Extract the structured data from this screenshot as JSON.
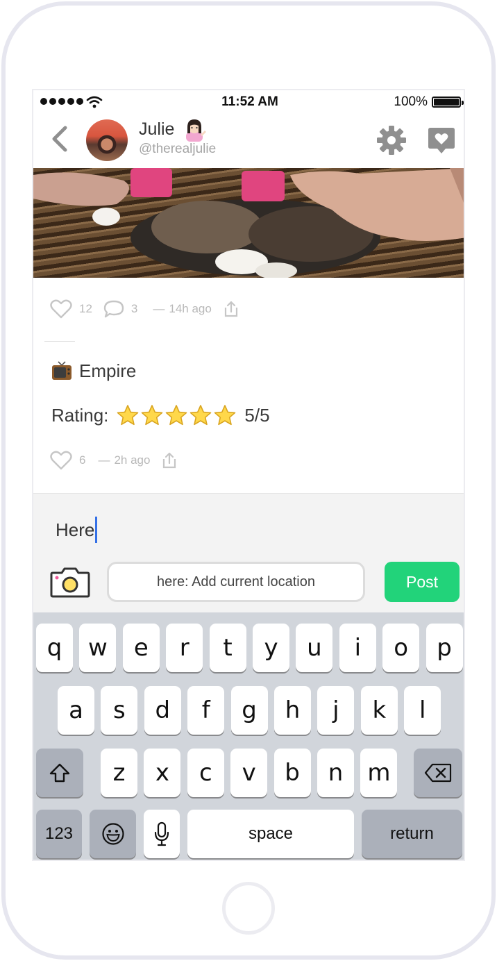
{
  "status_bar": {
    "time": "11:52 AM",
    "battery": "100%"
  },
  "header": {
    "display_name": "Julie",
    "username": "@therealjulie"
  },
  "posts": [
    {
      "likes": "12",
      "comments": "3",
      "separator": "—",
      "time": "14h ago"
    },
    {
      "show_title": "Empire",
      "rating_label": "Rating:",
      "stars": 5,
      "rating_value": "5/5",
      "likes": "6",
      "separator": "—",
      "time": "2h ago"
    }
  ],
  "composer": {
    "text": "Here",
    "location_label": "here: Add current location",
    "post_label": "Post"
  },
  "keyboard": {
    "row1": [
      "q",
      "w",
      "e",
      "r",
      "t",
      "y",
      "u",
      "i",
      "o",
      "p"
    ],
    "row2": [
      "a",
      "s",
      "d",
      "f",
      "g",
      "h",
      "j",
      "k",
      "l"
    ],
    "row3": [
      "z",
      "x",
      "c",
      "v",
      "b",
      "n",
      "m"
    ],
    "numbers_label": "123",
    "space_label": "space",
    "return_label": "return"
  },
  "colors": {
    "accent_green": "#22d37a",
    "caret_blue": "#3470e6",
    "keyboard_bg": "#d1d5db"
  },
  "icons": [
    "wifi-icon",
    "back-chevron-icon",
    "gear-icon",
    "heart-speech-icon",
    "heart-icon",
    "comment-icon",
    "share-icon",
    "tv-icon",
    "star-icon",
    "camera-icon",
    "shift-icon",
    "backspace-icon",
    "emoji-icon",
    "microphone-icon"
  ]
}
